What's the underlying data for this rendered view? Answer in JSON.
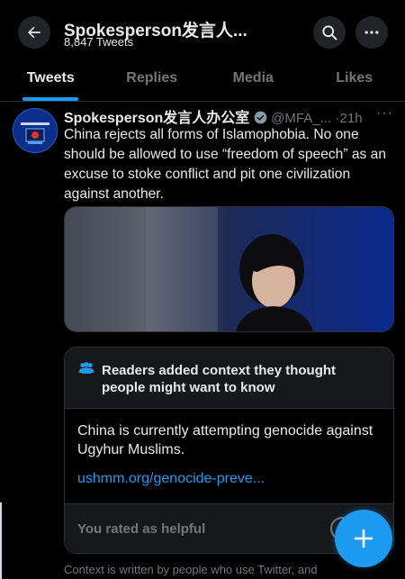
{
  "header": {
    "title": "Spokesperson发言人...",
    "tweet_count": "8,847 Tweets"
  },
  "tabs": [
    {
      "label": "Tweets",
      "active": true
    },
    {
      "label": "Replies",
      "active": false
    },
    {
      "label": "Media",
      "active": false
    },
    {
      "label": "Likes",
      "active": false
    }
  ],
  "tweet": {
    "name": "Spokesperson发言人办公室",
    "handle": "@MFA_...",
    "time": "·21h",
    "more": "···",
    "text": "China rejects all forms of Islamophobia. No one should be allowed to use “freedom of speech” as an excuse to stoke conflict and pit one civilization against another.",
    "media_alt": "Photo of spokesperson at podium"
  },
  "note": {
    "title": "Readers added context they thought people might want to know",
    "body": "China is currently attempting genocide against Ugyhur Muslims.",
    "link": "ushmm.org/genocide-preve...",
    "rated": "You rated as helpful"
  },
  "footer": {
    "text": "Context is written by people who use Twitter, and"
  },
  "colors": {
    "accent": "#1d9bf0",
    "background": "#000000",
    "secondary_text": "#71767b"
  }
}
